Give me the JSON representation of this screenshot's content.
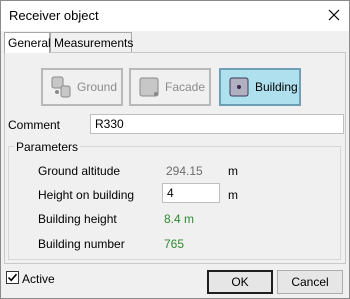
{
  "window": {
    "title": "Receiver object"
  },
  "tabs": [
    {
      "label": "General",
      "active": true
    },
    {
      "label": "Measurements",
      "active": false
    }
  ],
  "modes": {
    "ground": {
      "label": "Ground",
      "enabled": false
    },
    "facade": {
      "label": "Facade",
      "enabled": false
    },
    "building": {
      "label": "Building",
      "selected": true
    }
  },
  "comment": {
    "label": "Comment",
    "value": "R330"
  },
  "parameters": {
    "title": "Parameters",
    "ground_altitude": {
      "label": "Ground altitude",
      "value": "294.15",
      "unit": "m"
    },
    "height_on_building": {
      "label": "Height on building",
      "value": "4",
      "unit": "m"
    },
    "building_height": {
      "label": "Building height",
      "value": "8.4 m"
    },
    "building_number": {
      "label": "Building number",
      "value": "765"
    }
  },
  "active": {
    "label": "Active",
    "checked": true
  },
  "buttons": {
    "ok": "OK",
    "cancel": "Cancel"
  },
  "colors": {
    "selected_mode_bg": "#aee0ee",
    "value_green": "#2e8b2e"
  }
}
